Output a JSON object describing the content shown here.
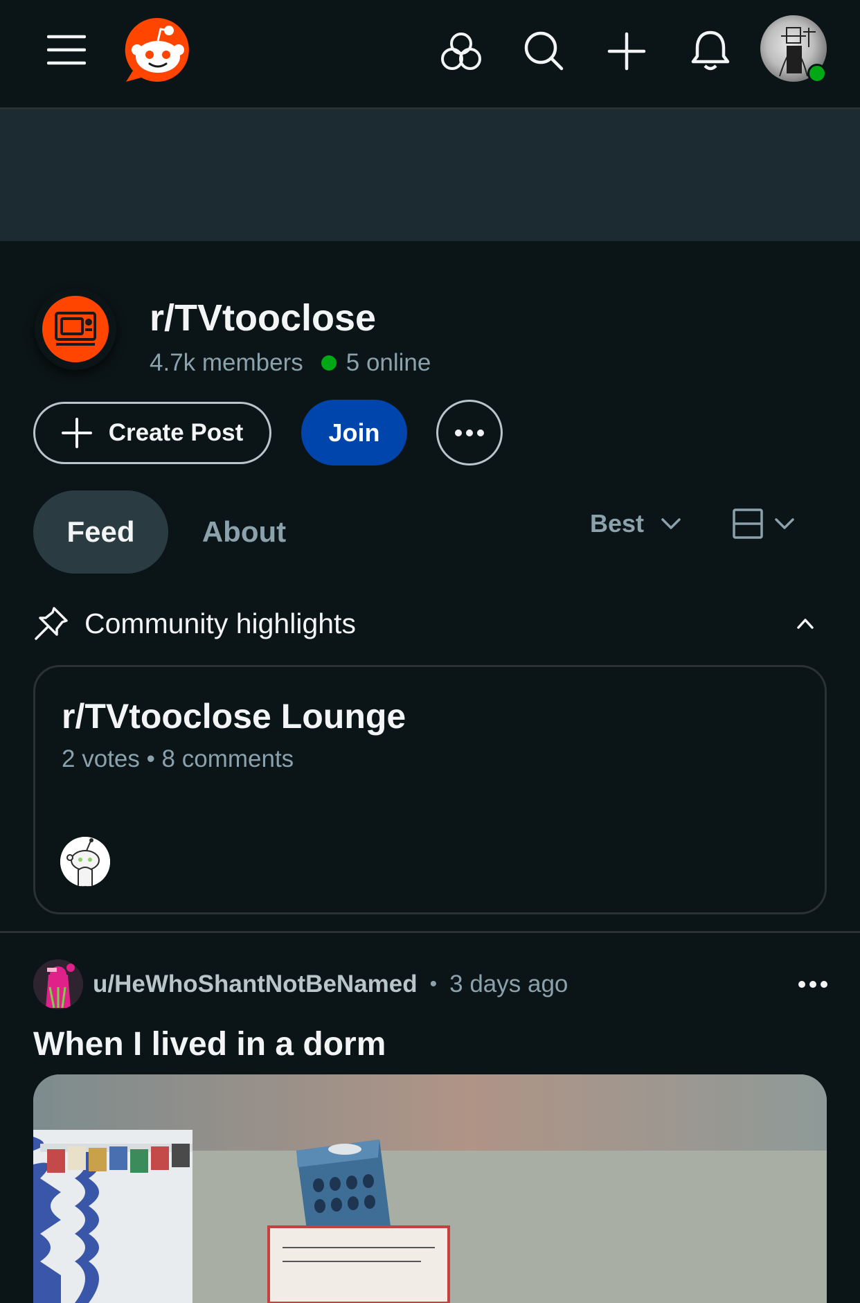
{
  "topbar": {
    "menu_icon": "menu-icon",
    "logo": "reddit-logo",
    "icons": [
      "communities-icon",
      "search-icon",
      "create-icon",
      "notifications-icon"
    ],
    "avatar": "user-avatar"
  },
  "subreddit": {
    "name": "r/TVtooclose",
    "members": "4.7k members",
    "online": "5 online",
    "icon": "tv-icon",
    "accent": "#ff4500"
  },
  "actions": {
    "create_post": "Create Post",
    "join": "Join"
  },
  "tabs": {
    "feed": "Feed",
    "about": "About"
  },
  "sort": {
    "label": "Best"
  },
  "highlights": {
    "title": "Community highlights",
    "card": {
      "title": "r/TVtooclose Lounge",
      "meta": "2 votes • 8 comments"
    }
  },
  "post": {
    "user": "u/HeWhoShantNotBeNamed",
    "separator": "•",
    "time": "3 days ago",
    "title": "When I lived in a dorm"
  },
  "colors": {
    "background": "#0b1416",
    "join": "#0045ac",
    "online": "#01a816",
    "muted": "#8ba2ad"
  }
}
